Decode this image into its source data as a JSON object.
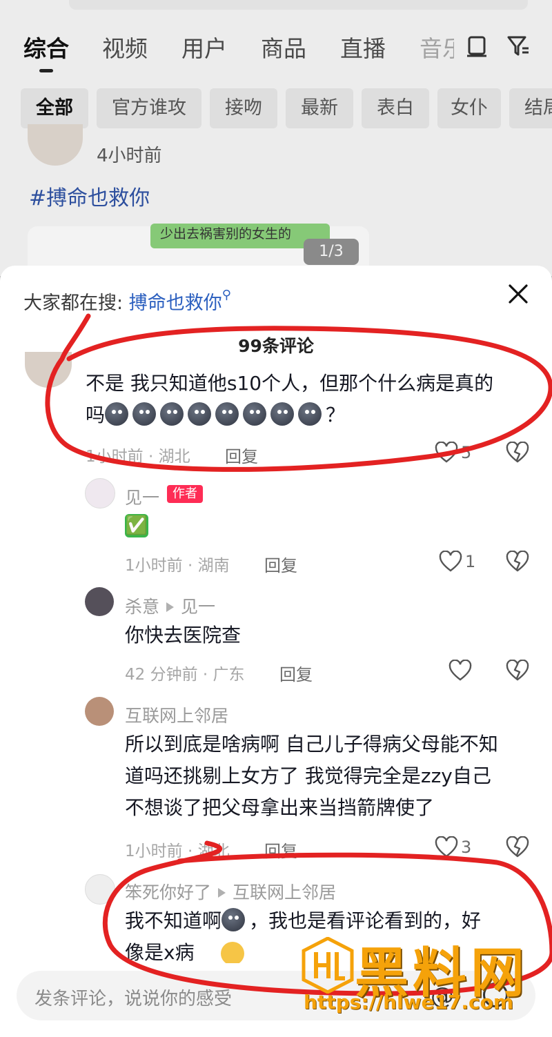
{
  "background": {
    "tabs": [
      {
        "label": "综合",
        "active": true
      },
      {
        "label": "视频"
      },
      {
        "label": "用户"
      },
      {
        "label": "商品"
      },
      {
        "label": "直播"
      },
      {
        "label": "音乐"
      }
    ],
    "chips": [
      {
        "label": "全部",
        "active": true
      },
      {
        "label": "官方谁攻"
      },
      {
        "label": "接吻"
      },
      {
        "label": "最新"
      },
      {
        "label": "表白"
      },
      {
        "label": "女仆"
      },
      {
        "label": "结局"
      }
    ],
    "post_time": "4小时前",
    "post_tag": "#搏命也救你",
    "image_bubble_text": "少出去祸害别的女生的",
    "image_counter": "1/3"
  },
  "panel": {
    "everyone_search_label": "大家都在搜:",
    "everyone_search_keyword": "搏命也救你",
    "comment_count": "99条评论"
  },
  "comments": [
    {
      "text_line1": "不是 我只知道他s10个人，但那个什么病是真的",
      "text_line2_prefix": "吗",
      "emoji_count": 8,
      "text_line2_suffix": "？",
      "meta": "1小时前 · 湖北",
      "reply": "回复",
      "likes": "5"
    },
    {
      "name": "见一",
      "badge": "作者",
      "emoji": "✅",
      "meta": "1小时前 · 湖南",
      "reply": "回复",
      "likes": "1"
    },
    {
      "name": "杀意",
      "reply_to": "见一",
      "text": "你快去医院查",
      "meta": "42 分钟前 · 广东",
      "reply": "回复",
      "likes": ""
    },
    {
      "name": "互联网上邻居",
      "text_line1": "所以到底是啥病啊 自己儿子得病父母能不知",
      "text_line2": "道吗还挑剔上女方了 我觉得完全是zzy自己",
      "text_line3": "不想谈了把父母拿出来当挡箭牌使了",
      "meta": "1小时前 · 湖北",
      "reply": "回复",
      "likes": "3"
    },
    {
      "name": "笨死你好了",
      "reply_to": "互联网上邻居",
      "text_line1_a": "我不知道啊",
      "text_line1_b": "，我也是看评论看到的，好",
      "text_line2": "像是x病"
    }
  ],
  "input": {
    "placeholder": "发条评论，说说你的感受"
  },
  "watermark": {
    "brand": "黑料网",
    "url": "https://hlwe17.com"
  },
  "colors": {
    "accent_red": "#fe2c55",
    "annotation_red": "#e32222",
    "link_blue": "#2b5fbf",
    "watermark_orange": "#f5a20a"
  }
}
